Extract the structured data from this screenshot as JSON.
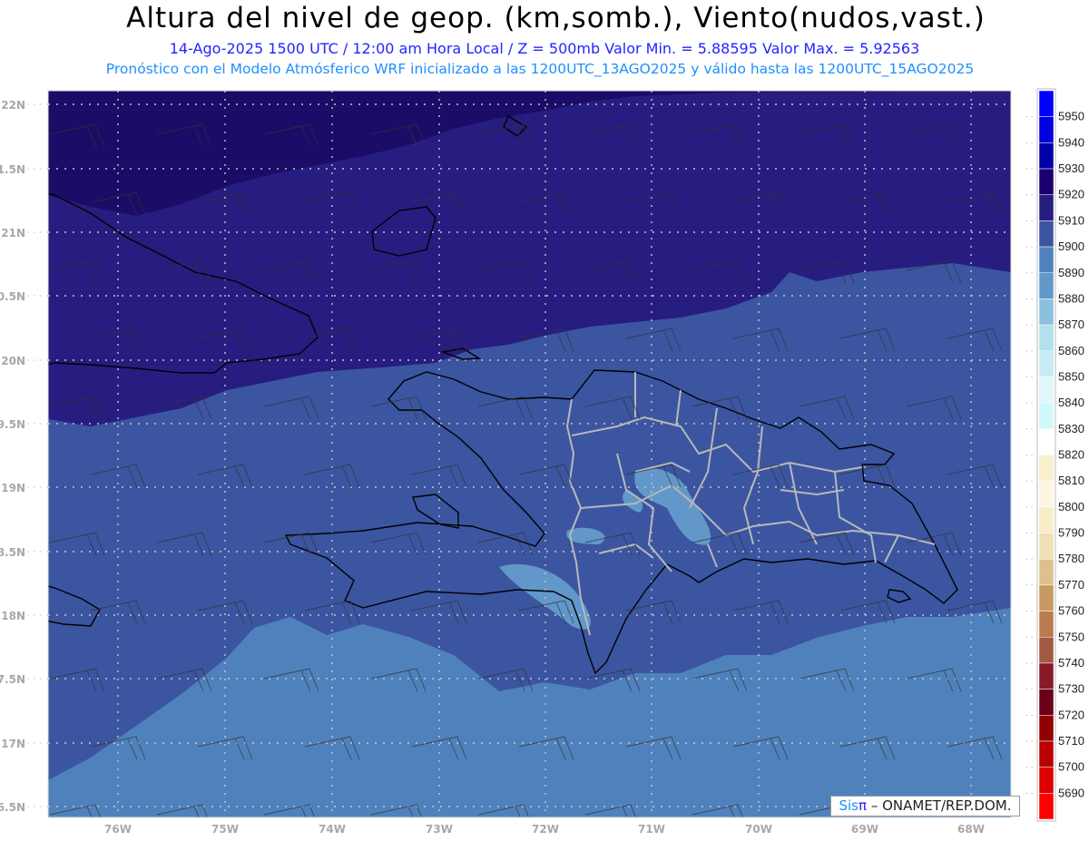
{
  "header": {
    "title": "Altura del nivel de geop. (km,somb.), Viento(nudos,vast.)",
    "subtitle_line1": "14-Ago-2025  1500 UTC / 12:00 am Hora Local / Z = 500mb   Valor Min. = 5.88595  Valor Max. = 5.92563",
    "subtitle_line2": "Pronóstico con el Modelo Atmósferico WRF inicializado a las 1200UTC_13AGO2025 y válido hasta las  1200UTC_15AGO2025"
  },
  "map": {
    "lon_labels": [
      "76W",
      "75W",
      "74W",
      "73W",
      "72W",
      "71W",
      "70W",
      "69W",
      "68W"
    ],
    "lat_labels": [
      "22N",
      "1.5N",
      "21N",
      "0.5N",
      "20N",
      "9.5N",
      "19N",
      "8.5N",
      "18N",
      "7.5N",
      "17N",
      "6.5N"
    ],
    "field_colors": {
      "5920": "#1b0c68",
      "5910": "#271d80",
      "5900": "#3b55a1",
      "5890": "#4f82bd",
      "5880": "#6198c9"
    }
  },
  "colorbar": {
    "labels": [
      "5950",
      "5940",
      "5930",
      "5920",
      "5910",
      "5900",
      "5890",
      "5880",
      "5870",
      "5860",
      "5850",
      "5840",
      "5830",
      "5820",
      "5810",
      "5800",
      "5790",
      "5780",
      "5770",
      "5760",
      "5750",
      "5740",
      "5730",
      "5720",
      "5710",
      "5700",
      "5690"
    ],
    "colors": [
      "#0000ff",
      "#0000e0",
      "#0000a8",
      "#1a006e",
      "#271d80",
      "#3b55a1",
      "#4f82bd",
      "#6198c9",
      "#8cc0df",
      "#b2e0ee",
      "#c6ecf4",
      "#e0f6fa",
      "#cdf9fb",
      "#ffffff",
      "#f8f0cc",
      "#fbf5e2",
      "#f7edc6",
      "#efe0b6",
      "#dcc08e",
      "#c89862",
      "#b87c4e",
      "#a25a40",
      "#881a28",
      "#6a0018",
      "#920000",
      "#ba0000",
      "#dc0000",
      "#ff0000"
    ]
  },
  "credit": {
    "sis": "Sis",
    "pi": "π",
    "org": " – ONAMET/REP.DOM."
  }
}
